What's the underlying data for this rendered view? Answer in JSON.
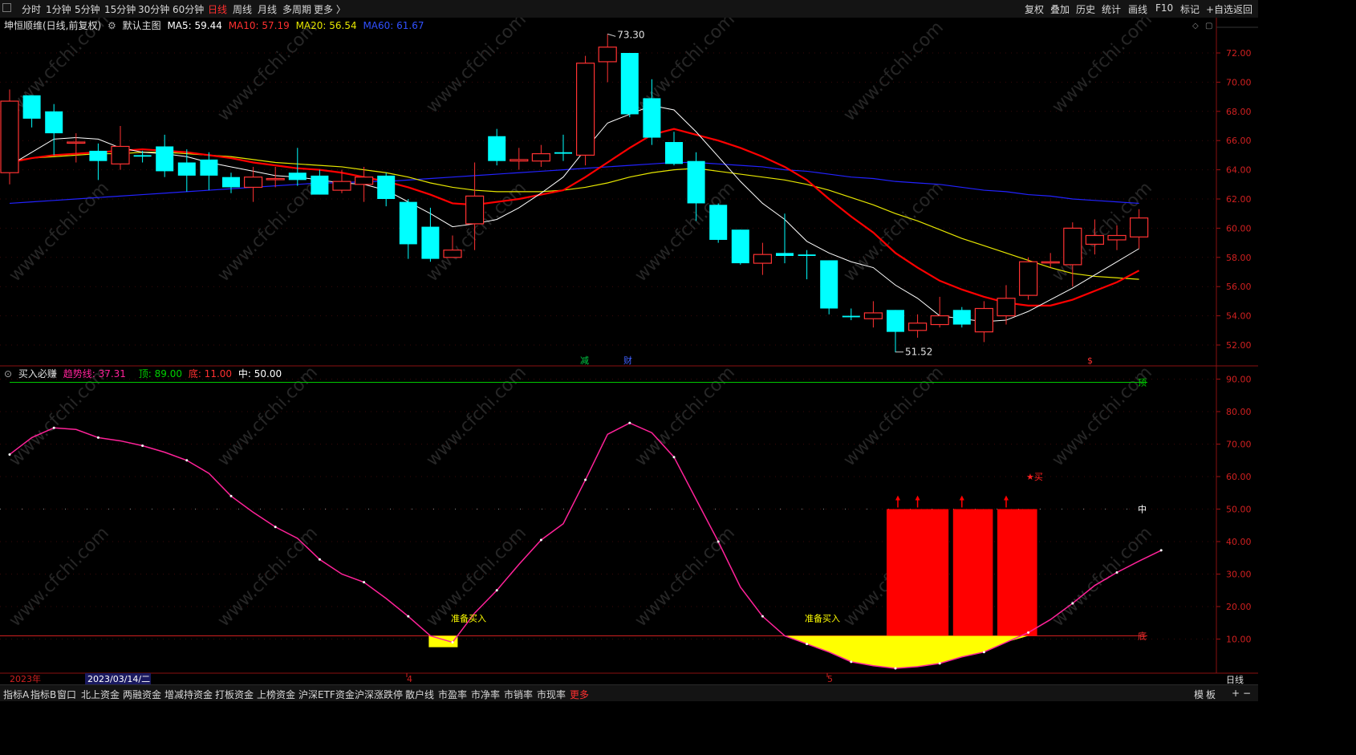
{
  "toolbar": {
    "tabs": [
      "分时",
      "1分钟",
      "5分钟",
      "15分钟",
      "30分钟",
      "60分钟",
      "日线",
      "周线",
      "月线",
      "多周期",
      "更多 〉"
    ],
    "active_index": 6,
    "right_buttons": [
      "复权",
      "叠加",
      "历史",
      "统计",
      "画线",
      "F10",
      "标记",
      "+自选",
      "返回"
    ]
  },
  "main_chart": {
    "stock_title": "坤恒顺维(日线,前复权)",
    "template": "默认主图",
    "ma5": "MA5: 59.44",
    "ma10": "MA10: 57.19",
    "ma20": "MA20: 56.54",
    "ma60": "MA60: 61.67",
    "high_label": "73.30",
    "low_label": "51.52",
    "y_ticks": [
      "72.00",
      "70.00",
      "68.00",
      "66.00",
      "64.00",
      "62.00",
      "60.00",
      "58.00",
      "56.00",
      "54.00",
      "52.00"
    ],
    "event_marks": [
      "减",
      "财",
      "$"
    ],
    "colors": {
      "up": "#ff3232",
      "down": "#00ffff",
      "ma5": "#ffffff",
      "ma10": "#ff0000",
      "ma20": "#e6e600",
      "ma60": "#2222ff"
    }
  },
  "indicator": {
    "name": "买入必赚",
    "trend_label": "趋势线: 37.31",
    "top_label": "顶: 89.00",
    "bottom_label": "底: 11.00",
    "mid_label": "中: 50.00",
    "y_ticks": [
      "90.00",
      "80.00",
      "70.00",
      "60.00",
      "50.00",
      "40.00",
      "30.00",
      "20.00",
      "10.00"
    ],
    "top_tag": "顶",
    "mid_tag": "中",
    "bottom_tag": "底",
    "prep_buy": "准备买入",
    "buy_signal": "★买",
    "colors": {
      "trend": "#ff2299",
      "top": "#00c800",
      "bottom": "#d02020",
      "bar_red": "#ff0000",
      "bar_yellow": "#ffff00"
    }
  },
  "xaxis": {
    "year_label": "2023年",
    "cursor_date": "2023/03/14/二",
    "month4": "4",
    "month5": "5",
    "period": "日线"
  },
  "watermark": "www.cfchi.com",
  "bottom_tabs": [
    "指标A",
    "指标B",
    "窗口",
    "北上资金",
    "两融资金",
    "增减持资金",
    "打板资金",
    "上榜资金",
    "沪深ETF资金",
    "沪深涨跌停",
    "散户线",
    "市盈率",
    "市净率",
    "市销率",
    "市现率",
    "更多"
  ],
  "bottom_right": [
    "模",
    "板",
    "+",
    "−"
  ],
  "chart_data": [
    {
      "type": "candlestick",
      "title": "坤恒顺维(日线,前复权)",
      "ylim": [
        51,
        73.5
      ],
      "candles": [
        {
          "o": 63.8,
          "c": 68.7,
          "h": 69.5,
          "l": 63.0
        },
        {
          "o": 69.1,
          "c": 67.5,
          "h": 69.1,
          "l": 66.9
        },
        {
          "o": 68.0,
          "c": 66.5,
          "h": 68.5,
          "l": 65.0
        },
        {
          "o": 65.9,
          "c": 65.9,
          "h": 66.5,
          "l": 64.5
        },
        {
          "o": 65.3,
          "c": 64.6,
          "h": 65.8,
          "l": 63.3
        },
        {
          "o": 64.4,
          "c": 65.6,
          "h": 67.0,
          "l": 64.0
        },
        {
          "o": 65.0,
          "c": 64.9,
          "h": 65.3,
          "l": 64.5
        },
        {
          "o": 65.6,
          "c": 63.9,
          "h": 66.4,
          "l": 63.5
        },
        {
          "o": 64.5,
          "c": 63.6,
          "h": 65.4,
          "l": 62.5
        },
        {
          "o": 64.7,
          "c": 63.6,
          "h": 65.2,
          "l": 62.6
        },
        {
          "o": 63.5,
          "c": 62.8,
          "h": 63.8,
          "l": 62.4
        },
        {
          "o": 62.8,
          "c": 63.5,
          "h": 64.2,
          "l": 61.8
        },
        {
          "o": 63.4,
          "c": 63.4,
          "h": 64.2,
          "l": 62.8
        },
        {
          "o": 63.8,
          "c": 63.3,
          "h": 65.5,
          "l": 62.9
        },
        {
          "o": 63.6,
          "c": 62.3,
          "h": 64.0,
          "l": 62.3
        },
        {
          "o": 62.6,
          "c": 63.2,
          "h": 64.0,
          "l": 62.4
        },
        {
          "o": 63.0,
          "c": 63.5,
          "h": 64.2,
          "l": 61.8
        },
        {
          "o": 63.6,
          "c": 62.0,
          "h": 63.8,
          "l": 61.5
        },
        {
          "o": 61.8,
          "c": 58.9,
          "h": 62.0,
          "l": 57.9
        },
        {
          "o": 60.1,
          "c": 57.9,
          "h": 61.4,
          "l": 57.7
        },
        {
          "o": 58.0,
          "c": 58.5,
          "h": 59.5,
          "l": 58.0
        },
        {
          "o": 60.3,
          "c": 62.2,
          "h": 64.5,
          "l": 58.5
        },
        {
          "o": 66.3,
          "c": 64.6,
          "h": 66.8,
          "l": 64.3
        },
        {
          "o": 64.6,
          "c": 64.7,
          "h": 65.5,
          "l": 64.0
        },
        {
          "o": 64.6,
          "c": 65.1,
          "h": 65.7,
          "l": 64.2
        },
        {
          "o": 65.2,
          "c": 65.1,
          "h": 66.4,
          "l": 64.6
        },
        {
          "o": 65.0,
          "c": 71.3,
          "h": 71.8,
          "l": 64.3
        },
        {
          "o": 71.4,
          "c": 72.4,
          "h": 73.3,
          "l": 70.0
        },
        {
          "o": 72.0,
          "c": 67.8,
          "h": 72.0,
          "l": 67.6
        },
        {
          "o": 68.9,
          "c": 66.2,
          "h": 70.2,
          "l": 65.7
        },
        {
          "o": 65.9,
          "c": 64.4,
          "h": 66.6,
          "l": 64.3
        },
        {
          "o": 64.6,
          "c": 61.7,
          "h": 65.2,
          "l": 60.5
        },
        {
          "o": 61.6,
          "c": 59.2,
          "h": 61.7,
          "l": 59.0
        },
        {
          "o": 59.9,
          "c": 57.6,
          "h": 59.9,
          "l": 57.5
        },
        {
          "o": 57.6,
          "c": 58.2,
          "h": 59.0,
          "l": 56.8
        },
        {
          "o": 58.3,
          "c": 58.1,
          "h": 61.0,
          "l": 57.6
        },
        {
          "o": 58.2,
          "c": 58.1,
          "h": 58.5,
          "l": 56.5
        },
        {
          "o": 57.8,
          "c": 54.5,
          "h": 57.8,
          "l": 54.1
        },
        {
          "o": 54.0,
          "c": 53.9,
          "h": 54.5,
          "l": 53.7
        },
        {
          "o": 53.8,
          "c": 54.2,
          "h": 55.0,
          "l": 53.2
        },
        {
          "o": 54.4,
          "c": 52.9,
          "h": 54.4,
          "l": 51.5
        },
        {
          "o": 53.0,
          "c": 53.5,
          "h": 54.1,
          "l": 52.5
        },
        {
          "o": 53.4,
          "c": 54.0,
          "h": 55.3,
          "l": 53.2
        },
        {
          "o": 54.4,
          "c": 53.4,
          "h": 54.6,
          "l": 53.2
        },
        {
          "o": 52.9,
          "c": 54.5,
          "h": 55.0,
          "l": 52.2
        },
        {
          "o": 54.0,
          "c": 55.2,
          "h": 56.1,
          "l": 53.4
        },
        {
          "o": 55.4,
          "c": 57.7,
          "h": 58.0,
          "l": 55.1
        },
        {
          "o": 57.7,
          "c": 57.7,
          "h": 58.3,
          "l": 57.3
        },
        {
          "o": 57.5,
          "c": 60.0,
          "h": 60.4,
          "l": 56.0
        },
        {
          "o": 58.9,
          "c": 59.5,
          "h": 60.6,
          "l": 58.2
        },
        {
          "o": 59.2,
          "c": 59.5,
          "h": 60.2,
          "l": 58.5
        },
        {
          "o": 59.4,
          "c": 60.7,
          "h": 61.3,
          "l": 58.6
        }
      ],
      "ma5": [
        64.3,
        65.2,
        66.1,
        66.2,
        66.1,
        65.5,
        65.2,
        65.1,
        64.9,
        64.5,
        64.2,
        63.9,
        63.6,
        63.5,
        63.3,
        63.1,
        63.0,
        62.6,
        61.8,
        61.0,
        60.1,
        60.3,
        60.6,
        61.4,
        62.4,
        63.5,
        65.4,
        67.2,
        67.8,
        68.4,
        68.1,
        66.6,
        64.9,
        63.2,
        61.7,
        60.6,
        59.1,
        58.3,
        57.7,
        57.3,
        56.1,
        55.2,
        54.0,
        53.8,
        53.6,
        53.7,
        54.3,
        55.1,
        55.9,
        56.8,
        57.7,
        58.6
      ],
      "ma10": [
        64.5,
        64.8,
        65.0,
        65.1,
        65.2,
        65.3,
        65.4,
        65.3,
        65.2,
        65.0,
        64.8,
        64.5,
        64.3,
        64.1,
        64.0,
        63.8,
        63.5,
        63.2,
        62.8,
        62.3,
        61.7,
        61.6,
        61.8,
        62.0,
        62.3,
        62.6,
        63.5,
        64.5,
        65.5,
        66.4,
        66.8,
        66.4,
        66.0,
        65.5,
        64.9,
        64.2,
        63.3,
        62.0,
        60.8,
        59.7,
        58.3,
        57.3,
        56.4,
        55.8,
        55.3,
        54.9,
        54.7,
        54.7,
        55.1,
        55.7,
        56.3,
        57.1
      ],
      "ma20": [
        64.6,
        64.8,
        64.9,
        65.0,
        65.1,
        65.1,
        65.2,
        65.2,
        65.1,
        65.0,
        64.9,
        64.7,
        64.5,
        64.4,
        64.3,
        64.2,
        64.0,
        63.8,
        63.5,
        63.1,
        62.8,
        62.6,
        62.5,
        62.5,
        62.5,
        62.6,
        62.8,
        63.1,
        63.5,
        63.8,
        64.0,
        64.1,
        63.9,
        63.7,
        63.5,
        63.3,
        63.0,
        62.6,
        62.1,
        61.6,
        61.0,
        60.5,
        59.9,
        59.3,
        58.8,
        58.3,
        57.8,
        57.3,
        56.9,
        56.7,
        56.6,
        56.5
      ],
      "ma60": [
        61.7,
        61.8,
        61.9,
        62.0,
        62.1,
        62.2,
        62.3,
        62.4,
        62.5,
        62.6,
        62.7,
        62.8,
        62.9,
        63.0,
        63.1,
        63.1,
        63.2,
        63.2,
        63.3,
        63.4,
        63.5,
        63.6,
        63.7,
        63.8,
        63.9,
        64.0,
        64.1,
        64.2,
        64.3,
        64.4,
        64.5,
        64.5,
        64.4,
        64.3,
        64.2,
        64.0,
        63.9,
        63.7,
        63.5,
        63.4,
        63.2,
        63.1,
        63.0,
        62.8,
        62.6,
        62.5,
        62.3,
        62.2,
        62.0,
        61.9,
        61.8,
        61.7
      ]
    },
    {
      "type": "line",
      "title": "买入必赚",
      "ylim": [
        0,
        93
      ],
      "top": 89.0,
      "mid": 50.0,
      "bottom": 11.0,
      "series": [
        {
          "name": "趋势线",
          "values": [
            66.8,
            72.0,
            75.0,
            74.5,
            72.0,
            71.0,
            69.5,
            67.5,
            65.0,
            61.0,
            54.0,
            49.0,
            44.5,
            41.0,
            34.5,
            30.0,
            27.5,
            22.5,
            17.0,
            11.0,
            9.0,
            18.0,
            25.0,
            33.0,
            40.5,
            45.5,
            59.0,
            73.0,
            76.5,
            73.5,
            66.0,
            53.0,
            40.0,
            26.0,
            17.0,
            11.0,
            8.5,
            6.0,
            3.0,
            1.8,
            1.0,
            1.5,
            2.5,
            4.5,
            6.0,
            9.0,
            12.0,
            16.0,
            21.0,
            26.5,
            30.5,
            34.0,
            37.3
          ]
        }
      ],
      "bars_red": [
        {
          "start": 40,
          "end": 42,
          "value": 50
        },
        {
          "start": 43,
          "end": 44,
          "value": 50
        },
        {
          "start": 45,
          "end": 46,
          "value": 50
        }
      ],
      "bars_yellow_below": [
        {
          "idx": 19,
          "value": 7.5
        },
        {
          "idx": 20,
          "value": 7.5
        }
      ],
      "fill_yellow": [
        {
          "from": 35,
          "to": 46
        }
      ]
    }
  ]
}
